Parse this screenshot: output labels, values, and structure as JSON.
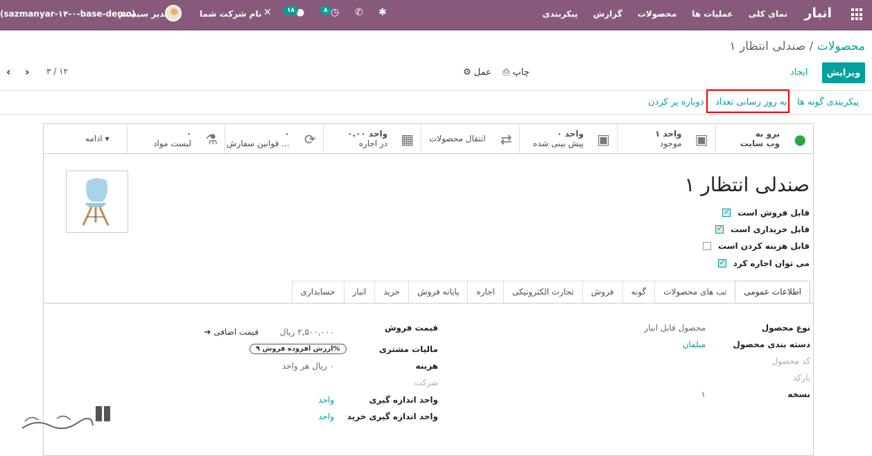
{
  "topbar": {
    "app": "انبار",
    "menu": [
      "نمای کلی",
      "عملیات ها",
      "محصولات",
      "گزارش",
      "پیکربندی"
    ],
    "db": "(sazmanyar-۱۴-۰-base-demo)",
    "user": "مدیر سیستم",
    "company": "نام شرکت شما",
    "badge_msgs": "۱۸",
    "badge_activity": "۸"
  },
  "breadcrumb": {
    "parent": "محصولات",
    "sep": "/",
    "current": "صندلی انتظار ۱"
  },
  "control": {
    "edit": "ویرایش",
    "create": "ایجاد",
    "print": "چاپ",
    "action": "عمل",
    "pager": "۳ / ۱۲"
  },
  "statusbar": {
    "variants": "پیکربندی گونه ها",
    "update_qty": "به روز رسانی تعداد",
    "replenish": "دوباره پر کردن"
  },
  "stats": [
    {
      "line1": "برو به",
      "line2": "وب سایت",
      "icon": "globe-icon"
    },
    {
      "line1": "۱ واحد",
      "line2": "موجود",
      "icon": "cubes-icon"
    },
    {
      "line1": "۰ واحد",
      "line2": "پیش بینی شده",
      "icon": "cubes-icon"
    },
    {
      "line1": "انتقال محصولات",
      "line2": "",
      "icon": "exchange-icon"
    },
    {
      "line1": "۰.۰۰ واحد",
      "line2": "در اجاره",
      "icon": "calendar-icon"
    },
    {
      "line1": "۰",
      "line2": "قوانین سفارش ...",
      "icon": "refresh-icon"
    },
    {
      "line1": "۰",
      "line2": "لیست مواد",
      "icon": "flask-icon"
    },
    {
      "line1": "ادامه",
      "line2": "",
      "icon": "caret-down-icon"
    }
  ],
  "product": {
    "name": "صندلی انتظار ۱"
  },
  "checks": [
    {
      "label": "قابل فروش است",
      "on": true
    },
    {
      "label": "قابل خریداری است",
      "on": true
    },
    {
      "label": "قابل هزینه کردن است",
      "on": false
    },
    {
      "label": "می توان اجاره کرد",
      "on": true
    }
  ],
  "tabs": [
    "اطلاعات عمومی",
    "تب های محصولات",
    "گونه",
    "فروش",
    "تجارت الکترونیکی",
    "اجاره",
    "پایانه فروش",
    "خرید",
    "انبار",
    "حسابداری"
  ],
  "left": {
    "type_l": "نوع محصول",
    "type_v": "محصول قابل انبار",
    "cat_l": "دسته بندی محصول",
    "cat_v": "مبلمان",
    "ref_ph": "کد محصول",
    "barcode_ph": "بارکد",
    "version_l": "نسخه",
    "version_v": "۱"
  },
  "right": {
    "price_l": "قیمت فروش",
    "price_v": "۲,۵۰۰,۰۰۰ ریال",
    "extra": "قیمت اضافی",
    "tax_l": "مالیات مشتری",
    "tax_v": "ارزش افزوده فروش ۹%",
    "cost_l": "هزینه",
    "cost_v": "۰ ریال هر واحد",
    "company_ph": "شرکت",
    "uom_l": "واحد اندازه گیری",
    "uom_v": "واحد",
    "puom_l": "واحد اندازه گیری خرید",
    "puom_v": "واحد"
  }
}
